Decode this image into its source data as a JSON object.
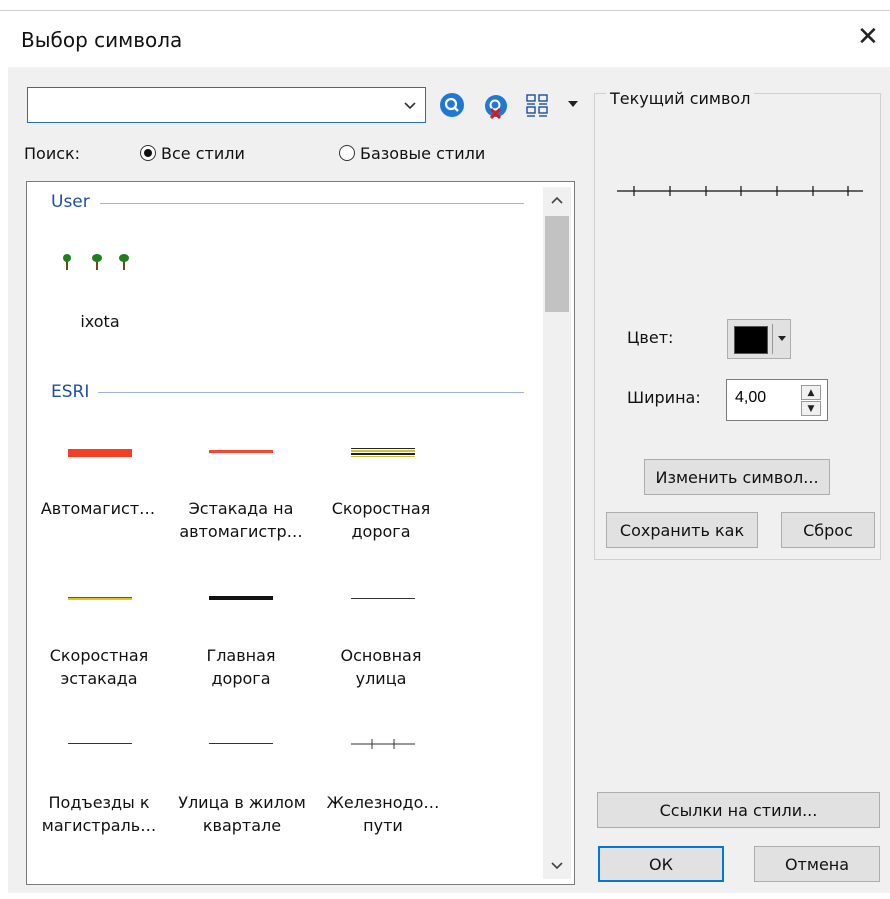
{
  "dialog": {
    "title": "Выбор символа",
    "close_glyph": "✕"
  },
  "search": {
    "value": "",
    "label": "Поиск:",
    "options": [
      {
        "label": "Все стили",
        "selected": true
      },
      {
        "label": "Базовые стили",
        "selected": false
      }
    ],
    "icons": [
      "search-icon",
      "clear-search-icon",
      "view-options-icon"
    ]
  },
  "groups": [
    {
      "name": "User",
      "items": [
        {
          "label": "ixota"
        }
      ]
    },
    {
      "name": "ESRI",
      "items": [
        {
          "label_lines": [
            "Автомагист…"
          ]
        },
        {
          "label_lines": [
            "Эстакада на",
            "автомагистр…"
          ]
        },
        {
          "label_lines": [
            "Скоростная",
            "дорога"
          ]
        },
        {
          "label_lines": [
            "Скоростная",
            "эстакада"
          ]
        },
        {
          "label_lines": [
            "Главная",
            "дорога"
          ]
        },
        {
          "label_lines": [
            "Основная",
            "улица"
          ]
        },
        {
          "label_lines": [
            "Подъезды к",
            "магистраль…"
          ]
        },
        {
          "label_lines": [
            "Улица в жилом",
            "квартале"
          ]
        },
        {
          "label_lines": [
            "Железнодо…",
            "пути"
          ]
        }
      ]
    }
  ],
  "current_symbol": {
    "legend": "Текущий символ",
    "color_label": "Цвет:",
    "color_value": "#000000",
    "width_label": "Ширина:",
    "width_value": "4,00",
    "edit_button": "Изменить символ...",
    "save_as_button": "Сохранить как",
    "reset_button": "Сброс"
  },
  "footer": {
    "style_refs_button": "Ссылки на стили...",
    "ok_button": "ОК",
    "cancel_button": "Отмена"
  },
  "colors": {
    "accent": "#0078d7",
    "group_header": "#1f4fa8",
    "highway": "#f43f24",
    "overpass": "#f4492f",
    "expressway_fill": "#c7c23a",
    "expressway_overpass": "#d4cc18"
  }
}
